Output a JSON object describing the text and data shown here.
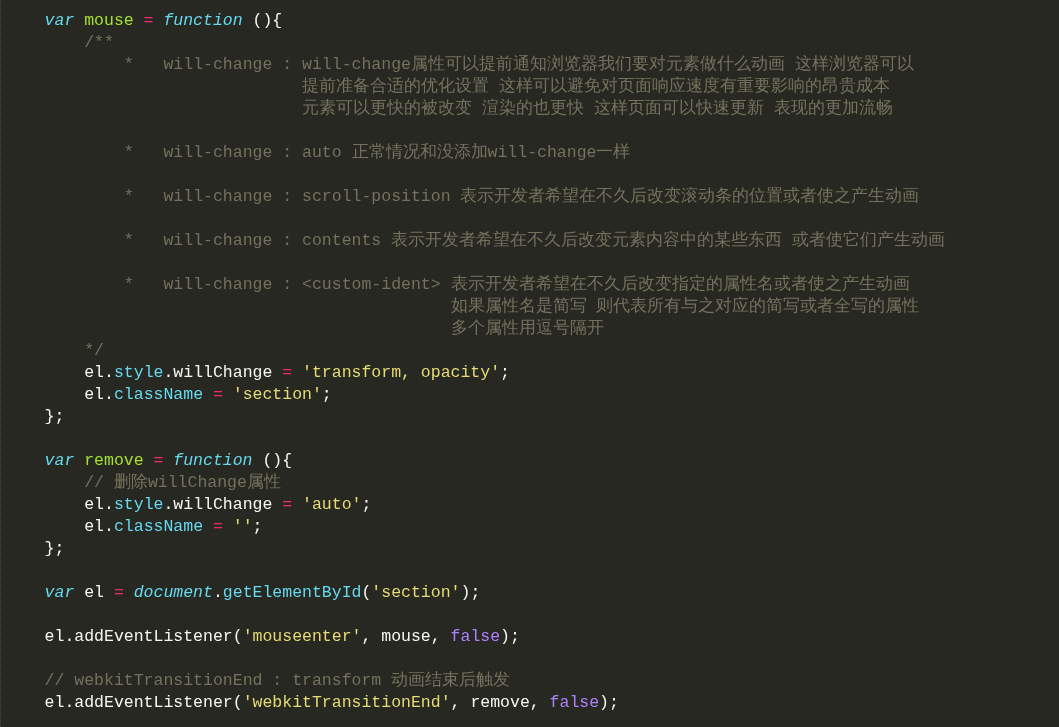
{
  "editor": {
    "lines": [
      {
        "kind": "code",
        "tokens": [
          {
            "kind": "storage",
            "text": "var"
          },
          {
            "kind": "entity",
            "text": "mouse",
            "space_before": true
          },
          {
            "kind": "op",
            "text": "=",
            "space_before": true
          },
          {
            "kind": "storage",
            "text": "function",
            "space_before": true
          },
          {
            "kind": "plain",
            "text": "(){",
            "space_before": true
          }
        ],
        "children": [
          {
            "kind": "comment",
            "text": "/**",
            "children": [
              {
                "kind": "doc",
                "bullet": "*",
                "key": "will-change",
                "separator": ":",
                "description": [
                  "will-change属性可以提前通知浏览器我们要对元素做什么动画 这样浏览器可以",
                  "提前准备合适的优化设置 这样可以避免对页面响应速度有重要影响的昂贵成本",
                  "元素可以更快的被改变 渲染的也更快 这样页面可以快速更新 表现的更加流畅"
                ]
              },
              {
                "kind": "blank"
              },
              {
                "kind": "doc",
                "bullet": "*",
                "key": "will-change",
                "separator": ":",
                "description": [
                  "auto 正常情况和没添加will-change一样"
                ]
              },
              {
                "kind": "blank"
              },
              {
                "kind": "doc",
                "bullet": "*",
                "key": "will-change",
                "separator": ":",
                "description": [
                  "scroll-position 表示开发者希望在不久后改变滚动条的位置或者使之产生动画"
                ]
              },
              {
                "kind": "blank"
              },
              {
                "kind": "doc",
                "bullet": "*",
                "key": "will-change",
                "separator": ":",
                "description": [
                  "contents 表示开发者希望在不久后改变元素内容中的某些东西 或者使它们产生动画"
                ]
              },
              {
                "kind": "blank"
              },
              {
                "kind": "doc",
                "bullet": "*",
                "key": "will-change",
                "separator": ":",
                "value": "<custom-ident>",
                "description": [
                  "表示开发者希望在不久后改变指定的属性名或者使之产生动画",
                  "如果属性名是简写 则代表所有与之对应的简写或者全写的属性",
                  "多个属性用逗号隔开"
                ]
              }
            ]
          },
          {
            "kind": "comment",
            "text": "*/"
          },
          {
            "kind": "code",
            "tokens": [
              {
                "kind": "plain",
                "text": "el."
              },
              {
                "kind": "prop",
                "text": "style"
              },
              {
                "kind": "plain",
                "text": ".willChange"
              },
              {
                "kind": "op",
                "text": "=",
                "space_before": true
              },
              {
                "kind": "string",
                "text": "'transform, opacity'",
                "space_before": true
              },
              {
                "kind": "plain",
                "text": ";"
              }
            ]
          },
          {
            "kind": "code",
            "tokens": [
              {
                "kind": "plain",
                "text": "el."
              },
              {
                "kind": "prop",
                "text": "className"
              },
              {
                "kind": "op",
                "text": "=",
                "space_before": true
              },
              {
                "kind": "string",
                "text": "'section'",
                "space_before": true
              },
              {
                "kind": "plain",
                "text": ";"
              }
            ]
          }
        ]
      },
      {
        "kind": "code",
        "tokens": [
          {
            "kind": "plain",
            "text": "};"
          }
        ]
      },
      {
        "kind": "blank"
      },
      {
        "kind": "code",
        "tokens": [
          {
            "kind": "storage",
            "text": "var"
          },
          {
            "kind": "entity",
            "text": "remove",
            "space_before": true
          },
          {
            "kind": "op",
            "text": "=",
            "space_before": true
          },
          {
            "kind": "storage",
            "text": "function",
            "space_before": true
          },
          {
            "kind": "plain",
            "text": "(){",
            "space_before": true
          }
        ],
        "children": [
          {
            "kind": "comment",
            "text": "// 删除willChange属性"
          },
          {
            "kind": "code",
            "tokens": [
              {
                "kind": "plain",
                "text": "el."
              },
              {
                "kind": "prop",
                "text": "style"
              },
              {
                "kind": "plain",
                "text": ".willChange"
              },
              {
                "kind": "op",
                "text": "=",
                "space_before": true
              },
              {
                "kind": "string",
                "text": "'auto'",
                "space_before": true
              },
              {
                "kind": "plain",
                "text": ";"
              }
            ]
          },
          {
            "kind": "code",
            "tokens": [
              {
                "kind": "plain",
                "text": "el."
              },
              {
                "kind": "prop",
                "text": "className"
              },
              {
                "kind": "op",
                "text": "=",
                "space_before": true
              },
              {
                "kind": "string",
                "text": "''",
                "space_before": true
              },
              {
                "kind": "plain",
                "text": ";"
              }
            ]
          }
        ]
      },
      {
        "kind": "code",
        "tokens": [
          {
            "kind": "plain",
            "text": "};"
          }
        ]
      },
      {
        "kind": "blank"
      },
      {
        "kind": "code",
        "tokens": [
          {
            "kind": "storage",
            "text": "var"
          },
          {
            "kind": "plain",
            "text": "el",
            "space_before": true
          },
          {
            "kind": "op",
            "text": "=",
            "space_before": true
          },
          {
            "kind": "builtin",
            "text": "document",
            "space_before": true
          },
          {
            "kind": "plain",
            "text": "."
          },
          {
            "kind": "prop",
            "text": "getElementById"
          },
          {
            "kind": "plain",
            "text": "("
          },
          {
            "kind": "string",
            "text": "'section'"
          },
          {
            "kind": "plain",
            "text": ");"
          }
        ]
      },
      {
        "kind": "blank"
      },
      {
        "kind": "code",
        "tokens": [
          {
            "kind": "plain",
            "text": "el.addEventListener("
          },
          {
            "kind": "string",
            "text": "'mouseenter'"
          },
          {
            "kind": "plain",
            "text": ","
          },
          {
            "kind": "plain",
            "text": "mouse,",
            "space_before": true
          },
          {
            "kind": "const",
            "text": "false",
            "space_before": true
          },
          {
            "kind": "plain",
            "text": ");"
          }
        ]
      },
      {
        "kind": "blank"
      },
      {
        "kind": "comment",
        "text": "// webkitTransitionEnd : transform 动画结束后触发"
      },
      {
        "kind": "code",
        "tokens": [
          {
            "kind": "plain",
            "text": "el.addEventListener("
          },
          {
            "kind": "string",
            "text": "'webkitTransitionEnd'"
          },
          {
            "kind": "plain",
            "text": ","
          },
          {
            "kind": "plain",
            "text": "remove,",
            "space_before": true
          },
          {
            "kind": "const",
            "text": "false",
            "space_before": true
          },
          {
            "kind": "plain",
            "text": ");"
          }
        ]
      }
    ]
  }
}
